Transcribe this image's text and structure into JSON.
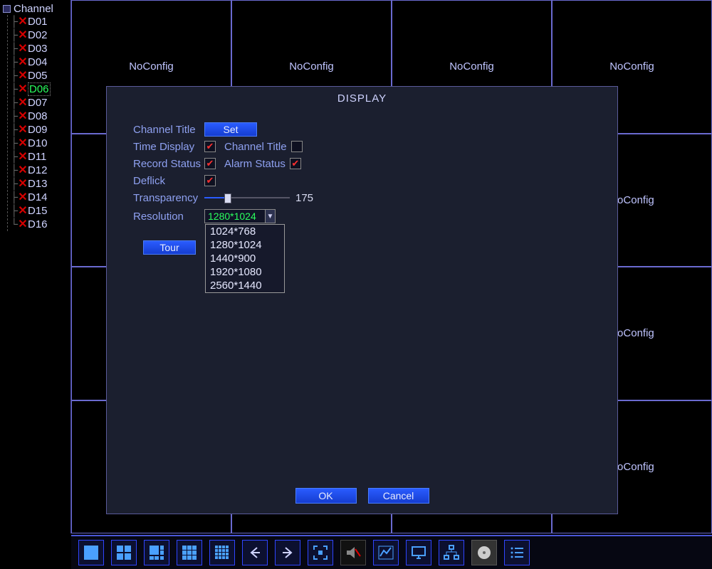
{
  "sidebar": {
    "header": "Channel",
    "channels": [
      {
        "name": "D01",
        "sel": false
      },
      {
        "name": "D02",
        "sel": false
      },
      {
        "name": "D03",
        "sel": false
      },
      {
        "name": "D04",
        "sel": false
      },
      {
        "name": "D05",
        "sel": false
      },
      {
        "name": "D06",
        "sel": true
      },
      {
        "name": "D07",
        "sel": false
      },
      {
        "name": "D08",
        "sel": false
      },
      {
        "name": "D09",
        "sel": false
      },
      {
        "name": "D10",
        "sel": false
      },
      {
        "name": "D11",
        "sel": false
      },
      {
        "name": "D12",
        "sel": false
      },
      {
        "name": "D13",
        "sel": false
      },
      {
        "name": "D14",
        "sel": false
      },
      {
        "name": "D15",
        "sel": false
      },
      {
        "name": "D16",
        "sel": false
      }
    ]
  },
  "grid_label": "NoConfig",
  "dialog": {
    "title": "DISPLAY",
    "labels": {
      "channel_title": "Channel Title",
      "time_display": "Time Display",
      "channel_title2": "Channel Title",
      "record_status": "Record Status",
      "alarm_status": "Alarm Status",
      "deflick": "Deflick",
      "transparency": "Transparency",
      "resolution": "Resolution"
    },
    "set_btn": "Set",
    "tour_btn": "Tour",
    "transparency_value": "175",
    "resolution_selected": "1280*1024",
    "resolution_options": [
      "1024*768",
      "1280*1024",
      "1440*900",
      "1920*1080",
      "2560*1440"
    ],
    "ok": "OK",
    "cancel": "Cancel",
    "checkboxes": {
      "time_display": true,
      "channel_title": false,
      "record_status": true,
      "alarm_status": true,
      "deflick": true
    }
  },
  "toolbar_names": [
    "view-1",
    "view-4",
    "view-8",
    "view-9",
    "view-16",
    "prev",
    "next",
    "fullscreen",
    "mute",
    "chart",
    "monitor",
    "network",
    "storage",
    "list"
  ]
}
